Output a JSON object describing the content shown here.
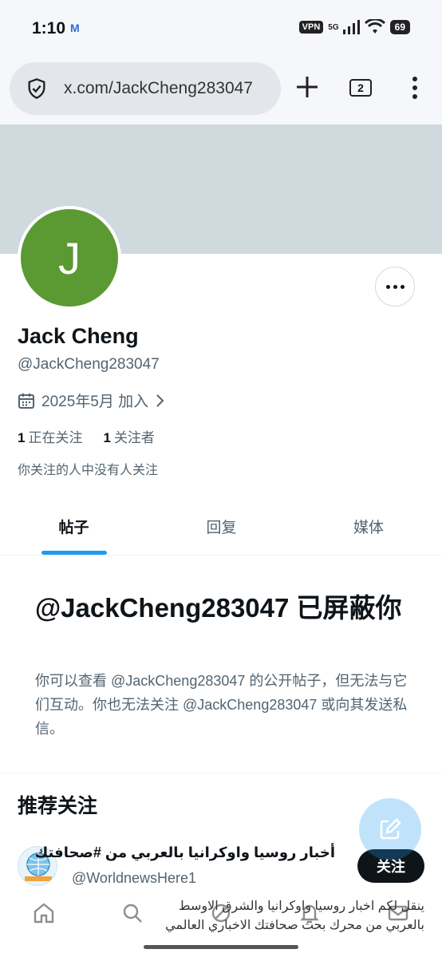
{
  "status_bar": {
    "time": "1:10",
    "notification_icon": "M",
    "vpn": "VPN",
    "network": "5G",
    "battery": "69"
  },
  "browser": {
    "url": "x.com/JackCheng283047",
    "tab_count": "2"
  },
  "profile": {
    "avatar_letter": "J",
    "avatar_color": "#5b9a32",
    "name": "Jack Cheng",
    "handle": "@JackCheng283047",
    "joined": "2025年5月 加入",
    "following_count": "1",
    "following_label": "正在关注",
    "followers_count": "1",
    "followers_label": "关注者",
    "mutual_note": "你关注的人中没有人关注"
  },
  "tabs": [
    {
      "label": "帖子",
      "active": true
    },
    {
      "label": "回复",
      "active": false
    },
    {
      "label": "媒体",
      "active": false
    }
  ],
  "blocked": {
    "title": "@JackCheng283047 已屏蔽你",
    "description": "你可以查看 @JackCheng283047 的公开帖子，但无法与它们互动。你也无法关注 @JackCheng283047 或向其发送私信。"
  },
  "suggestions": {
    "title": "推荐关注",
    "items": [
      {
        "name": "أخبار روسيا واوكرانيا بالعربي من #صحافتك",
        "handle": "@WorldnewsHere1",
        "follow_label": "关注",
        "bio": "ينقل لكم اخبار روسيا واوكرانيا والشرق الاوسط بالعربي من محرك بحث صحافتك الاخباري العالمي"
      }
    ]
  },
  "colors": {
    "accent": "#1d9bf0",
    "banner": "#cfd9de",
    "text_secondary": "#536471"
  }
}
